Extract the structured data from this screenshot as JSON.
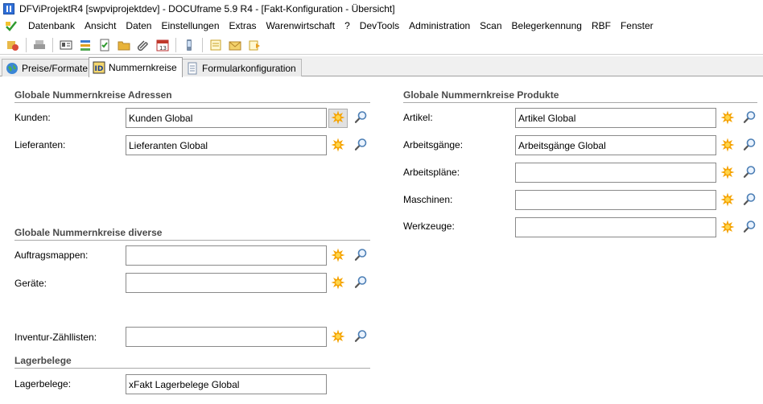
{
  "window": {
    "title": "DFViProjektR4 [swpviprojektdev] - DOCUframe 5.9 R4 - [Fakt-Konfiguration - Übersicht]"
  },
  "menu": [
    "Datenbank",
    "Ansicht",
    "Daten",
    "Einstellungen",
    "Extras",
    "Warenwirtschaft",
    "?",
    "DevTools",
    "Administration",
    "Scan",
    "Belegerkennung",
    "RBF",
    "Fenster"
  ],
  "tabs": [
    {
      "label": "Preise/Formate"
    },
    {
      "label": "Nummernkreise"
    },
    {
      "label": "Formularkonfiguration"
    }
  ],
  "left": {
    "adressen_title": "Globale Nummernkreise Adressen",
    "kunden": {
      "label": "Kunden:",
      "value": "Kunden Global"
    },
    "lieferanten": {
      "label": "Lieferanten:",
      "value": "Lieferanten Global"
    },
    "diverse_title": "Globale Nummernkreise diverse",
    "auftragsmappen": {
      "label": "Auftragsmappen:",
      "value": ""
    },
    "geraete": {
      "label": "Geräte:",
      "value": ""
    },
    "inventur": {
      "label": "Inventur-Zähllisten:",
      "value": ""
    },
    "lager_title": "Lagerbelege",
    "lagerbelege": {
      "label": "Lagerbelege:",
      "value": "xFakt Lagerbelege Global"
    }
  },
  "right": {
    "produkte_title": "Globale Nummernkreise Produkte",
    "artikel": {
      "label": "Artikel:",
      "value": "Artikel Global"
    },
    "arbeitsgaenge": {
      "label": "Arbeitsgänge:",
      "value": "Arbeitsgänge Global"
    },
    "arbeitsplaene": {
      "label": "Arbeitspläne:",
      "value": ""
    },
    "maschinen": {
      "label": "Maschinen:",
      "value": ""
    },
    "werkzeuge": {
      "label": "Werkzeuge:",
      "value": ""
    }
  },
  "colors": {
    "star": "#f5a300",
    "search": "#4d7fb5",
    "section_text": "#4a4a4a"
  }
}
